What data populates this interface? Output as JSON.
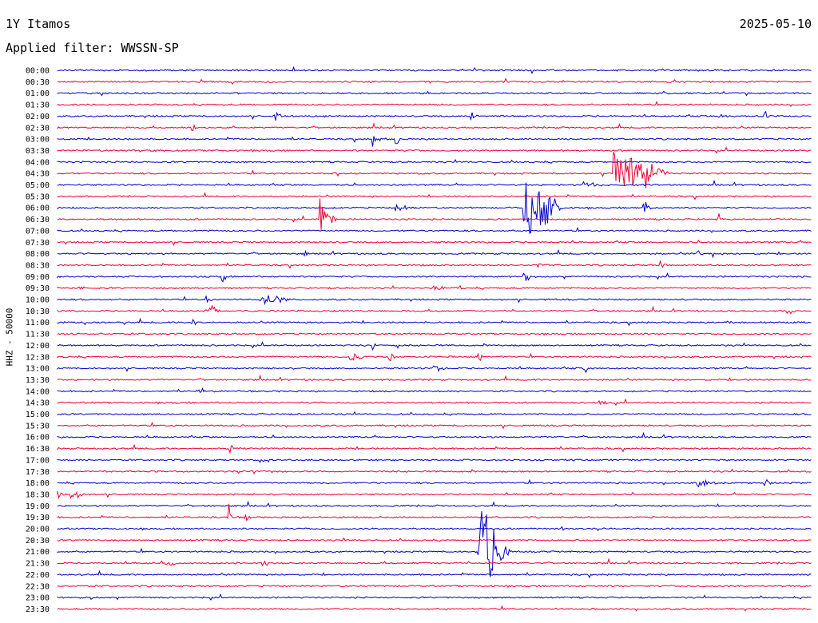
{
  "header": {
    "station": "1Y Itamos",
    "date": "2025-05-10",
    "filter": "Applied filter: WWSSN-SP"
  },
  "chart_data": {
    "type": "line",
    "title": "1Y Itamos",
    "ylabel": "HHZ - 50000",
    "colors": [
      "#0000cc",
      "#ee0033"
    ],
    "times": [
      "00:00",
      "00:30",
      "01:00",
      "01:30",
      "02:00",
      "02:30",
      "03:00",
      "03:30",
      "04:00",
      "04:30",
      "05:00",
      "05:30",
      "06:00",
      "06:30",
      "07:00",
      "07:30",
      "08:00",
      "08:30",
      "09:00",
      "09:30",
      "10:00",
      "10:30",
      "11:00",
      "11:30",
      "12:00",
      "12:30",
      "13:00",
      "13:30",
      "14:00",
      "14:30",
      "15:00",
      "15:30",
      "16:00",
      "16:30",
      "17:00",
      "17:30",
      "18:00",
      "18:30",
      "19:00",
      "19:30",
      "20:00",
      "20:30",
      "21:00",
      "21:30",
      "22:00",
      "22:30",
      "23:00",
      "23:30"
    ],
    "events": [
      {
        "trace": "00:30",
        "pos": 0.28,
        "amp": 2,
        "dur": 0.02
      },
      {
        "trace": "02:00",
        "pos": 0.29,
        "amp": 8,
        "dur": 0.01
      },
      {
        "trace": "02:00",
        "pos": 0.55,
        "amp": 6,
        "dur": 0.01
      },
      {
        "trace": "02:00",
        "pos": 0.88,
        "amp": 3,
        "dur": 0.02
      },
      {
        "trace": "02:00",
        "pos": 0.94,
        "amp": 9,
        "dur": 0.003
      },
      {
        "trace": "02:30",
        "pos": 0.18,
        "amp": 8,
        "dur": 0.01
      },
      {
        "trace": "03:00",
        "pos": 0.42,
        "amp": 9,
        "dur": 0.01
      },
      {
        "trace": "03:00",
        "pos": 0.45,
        "amp": 12,
        "dur": 0.003
      },
      {
        "trace": "03:30",
        "pos": 0.11,
        "amp": 2,
        "dur": 0.06
      },
      {
        "trace": "04:30",
        "pos": 0.37,
        "amp": 5,
        "dur": 0.005
      },
      {
        "trace": "04:30",
        "pos": 0.74,
        "amp": 45,
        "dur": 0.07
      },
      {
        "trace": "05:00",
        "pos": 0.7,
        "amp": 4,
        "dur": 0.04
      },
      {
        "trace": "06:00",
        "pos": 0.45,
        "amp": 5,
        "dur": 0.03
      },
      {
        "trace": "06:00",
        "pos": 0.62,
        "amp": 45,
        "dur": 0.03
      },
      {
        "trace": "06:00",
        "pos": 0.64,
        "amp": 50,
        "dur": 0.03
      },
      {
        "trace": "06:00",
        "pos": 0.78,
        "amp": 8,
        "dur": 0.01
      },
      {
        "trace": "06:30",
        "pos": 0.35,
        "amp": 28,
        "dur": 0.02
      },
      {
        "trace": "06:30",
        "pos": 0.88,
        "amp": 8,
        "dur": 0.003
      },
      {
        "trace": "08:00",
        "pos": 0.33,
        "amp": 5,
        "dur": 0.003
      },
      {
        "trace": "08:00",
        "pos": 0.85,
        "amp": 6,
        "dur": 0.01
      },
      {
        "trace": "08:30",
        "pos": 0.8,
        "amp": 9,
        "dur": 0.01
      },
      {
        "trace": "08:30",
        "pos": 0.64,
        "amp": 5,
        "dur": 0.01
      },
      {
        "trace": "09:00",
        "pos": 0.62,
        "amp": 7,
        "dur": 0.02
      },
      {
        "trace": "09:00",
        "pos": 0.22,
        "amp": 7,
        "dur": 0.003
      },
      {
        "trace": "09:30",
        "pos": 0.03,
        "amp": 5,
        "dur": 0.01
      },
      {
        "trace": "09:30",
        "pos": 0.5,
        "amp": 5,
        "dur": 0.02
      },
      {
        "trace": "10:00",
        "pos": 0.27,
        "amp": 10,
        "dur": 0.05
      },
      {
        "trace": "10:00",
        "pos": 0.2,
        "amp": 6,
        "dur": 0.01
      },
      {
        "trace": "10:30",
        "pos": 0.2,
        "amp": 9,
        "dur": 0.02
      },
      {
        "trace": "10:30",
        "pos": 0.97,
        "amp": 10,
        "dur": 0.01
      },
      {
        "trace": "11:00",
        "pos": 0.18,
        "amp": 6,
        "dur": 0.003
      },
      {
        "trace": "11:00",
        "pos": 0.89,
        "amp": 5,
        "dur": 0.01
      },
      {
        "trace": "12:00",
        "pos": 0.42,
        "amp": 9,
        "dur": 0.003
      },
      {
        "trace": "12:30",
        "pos": 0.39,
        "amp": 9,
        "dur": 0.02
      },
      {
        "trace": "12:30",
        "pos": 0.56,
        "amp": 8,
        "dur": 0.003
      },
      {
        "trace": "12:30",
        "pos": 0.44,
        "amp": 7,
        "dur": 0.01
      },
      {
        "trace": "13:00",
        "pos": 0.5,
        "amp": 6,
        "dur": 0.02
      },
      {
        "trace": "13:00",
        "pos": 0.7,
        "amp": 10,
        "dur": 0.003
      },
      {
        "trace": "14:00",
        "pos": 0.19,
        "amp": 5,
        "dur": 0.003
      },
      {
        "trace": "14:30",
        "pos": 0.72,
        "amp": 5,
        "dur": 0.02
      },
      {
        "trace": "16:30",
        "pos": 0.23,
        "amp": 8,
        "dur": 0.003
      },
      {
        "trace": "17:00",
        "pos": 0.27,
        "amp": 5,
        "dur": 0.02
      },
      {
        "trace": "17:30",
        "pos": 0.26,
        "amp": 3,
        "dur": 0.02
      },
      {
        "trace": "18:00",
        "pos": 0.85,
        "amp": 6,
        "dur": 0.03
      },
      {
        "trace": "18:00",
        "pos": 0.94,
        "amp": 8,
        "dur": 0.003
      },
      {
        "trace": "18:30",
        "pos": 0.0,
        "amp": 9,
        "dur": 0.01
      },
      {
        "trace": "18:30",
        "pos": 0.02,
        "amp": 8,
        "dur": 0.02
      },
      {
        "trace": "19:30",
        "pos": 0.23,
        "amp": 18,
        "dur": 0.003
      },
      {
        "trace": "19:30",
        "pos": 0.25,
        "amp": 8,
        "dur": 0.01
      },
      {
        "trace": "20:00",
        "pos": 0.67,
        "amp": 5,
        "dur": 0.003
      },
      {
        "trace": "21:00",
        "pos": 0.56,
        "amp": 82,
        "dur": 0.04
      },
      {
        "trace": "21:30",
        "pos": 0.27,
        "amp": 6,
        "dur": 0.02
      },
      {
        "trace": "21:30",
        "pos": 0.14,
        "amp": 5,
        "dur": 0.03
      },
      {
        "trace": "23:00",
        "pos": 0.04,
        "amp": 5,
        "dur": 0.02
      }
    ]
  }
}
